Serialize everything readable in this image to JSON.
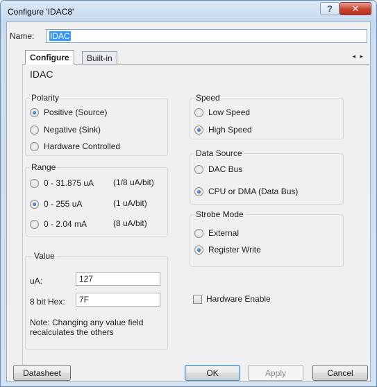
{
  "window": {
    "title": "Configure 'IDAC8'",
    "help_glyph": "?",
    "close_glyph": "✕"
  },
  "name": {
    "label": "Name:",
    "value": "IDAC"
  },
  "tabs": [
    {
      "label": "Configure"
    },
    {
      "label": "Built-in"
    }
  ],
  "tab_arrows": "◂ ▸",
  "panel_title": "IDAC",
  "polarity": {
    "title": "Polarity",
    "options": [
      {
        "label": "Positive (Source)",
        "selected": true
      },
      {
        "label": "Negative (Sink)",
        "selected": false
      },
      {
        "label": "Hardware Controlled",
        "selected": false
      }
    ]
  },
  "range": {
    "title": "Range",
    "options": [
      {
        "label": "0 - 31.875 uA",
        "resolution": "(1/8 uA/bit)",
        "selected": false
      },
      {
        "label": "0 - 255 uA",
        "resolution": "(1 uA/bit)",
        "selected": true
      },
      {
        "label": "0 - 2.04 mA",
        "resolution": "(8 uA/bit)",
        "selected": false
      }
    ]
  },
  "value": {
    "title": "Value",
    "ua_label": "uA:",
    "ua_value": "127",
    "hex_label": "8 bit Hex:",
    "hex_value": "7F",
    "note": "Note: Changing any value field recalculates the others"
  },
  "speed": {
    "title": "Speed",
    "options": [
      {
        "label": "Low Speed",
        "selected": false
      },
      {
        "label": "High Speed",
        "selected": true
      }
    ]
  },
  "data_source": {
    "title": "Data Source",
    "options": [
      {
        "label": "DAC Bus",
        "selected": false
      },
      {
        "label": "CPU or DMA (Data Bus)",
        "selected": true
      }
    ]
  },
  "strobe_mode": {
    "title": "Strobe Mode",
    "options": [
      {
        "label": "External",
        "selected": false
      },
      {
        "label": "Register Write",
        "selected": true
      }
    ]
  },
  "hardware_enable": {
    "label": "Hardware Enable",
    "checked": false
  },
  "buttons": {
    "datasheet": "Datasheet",
    "ok": "OK",
    "apply": "Apply",
    "cancel": "Cancel"
  }
}
